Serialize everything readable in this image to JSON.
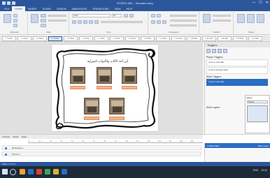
{
  "window": {
    "title": "STORYLINE – Scenario.story",
    "controls": [
      "—",
      "☐",
      "✕"
    ]
  },
  "ribbon": {
    "tabs": [
      "FILE",
      "HOME",
      "INSERT",
      "SLIDES",
      "DESIGN",
      "ANIMATIONS",
      "TRANSITIONS",
      "VIEW",
      "HELP"
    ],
    "active_tab": "HOME",
    "groups": [
      "Clipboard",
      "Slide",
      "Font",
      "Paragraph",
      "Publish",
      "Player"
    ],
    "font_name": "Arial",
    "font_size": "18"
  },
  "strip": {
    "thumbs": [
      "1.1 Slide",
      "1.2 Slide",
      "1.3 Slide",
      "1.4 Slide",
      "1.5 Slide",
      "1.6 Slide",
      "1.7 Slide",
      "1.8 Slide",
      "1.9 Slide",
      "1.10 Slide",
      "1.11 Slide",
      "1.12 Slide",
      "1.13 Slide",
      "1.14 Slide",
      "1.15 Slide",
      "1.16 Slide",
      "1.17 Slide"
    ]
  },
  "slide": {
    "title": "أين أجد الأثاث والأدوات المنزلية",
    "captions": [
      "",
      "",
      "",
      "",
      ""
    ]
  },
  "panel": {
    "header": "Triggers",
    "sections": [
      {
        "label": "Player Triggers"
      },
      {
        "label": "Slide Triggers"
      }
    ],
    "items": [
      {
        "text": "Jump to next slide",
        "selected": false
      },
      {
        "text": "Jump to previous slide",
        "selected": false
      },
      {
        "text": "Jump to next slide",
        "selected": true
      }
    ],
    "layers_title": "Slide Layers",
    "subwindow_title": "States",
    "subwindow_dropdown": "Normal"
  },
  "timeline": {
    "tabs": [
      "Timeline",
      "States",
      "Notes"
    ],
    "ruler": [
      "1s",
      "2s",
      "3s",
      "4s",
      "5s",
      "6s",
      "7s",
      "8s",
      "9s",
      "10s",
      "11s",
      "12s",
      "13s",
      "14s",
      "15s",
      "16s"
    ],
    "rows": [
      "Rectangle 1",
      "Picture 1"
    ]
  },
  "bottom_panel": {
    "left": "Untitled Slide",
    "right": "Base Layer"
  },
  "status": {
    "text": "Slide 1.4 of 17"
  },
  "taskbar": {
    "app_colors": [
      "#e5a23a",
      "#2b6cc4",
      "#d2452c",
      "#3aa757",
      "#d4b338",
      "#2b6cc4"
    ],
    "tray": [
      "ENG",
      "10:42"
    ]
  },
  "colors": {
    "accent": "#2b579a",
    "selection": "#2b6cc4",
    "caption": "#f3b38a"
  }
}
